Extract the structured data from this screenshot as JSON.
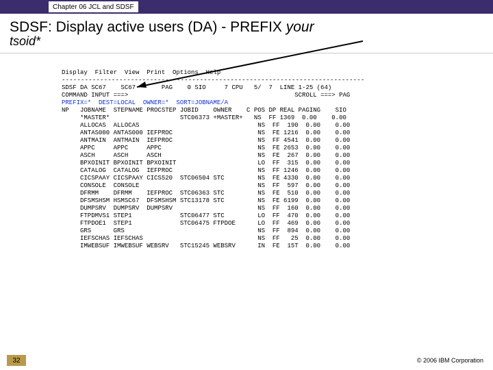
{
  "chapter_tab": "Chapter 06 JCL and SDSF",
  "title_line1_a": "SDSF: Display active users (DA)  -   PREFIX ",
  "title_line1_b": "your",
  "title_line2": "tsoid*",
  "menu_line": "Display  Filter  View  Print  Options  Help",
  "dashes": "-------------------------------------------------------------------------------",
  "status_line": "SDSF DA SC67    SC67       PAG    0 SIO     7 CPU   5/  7  LINE 1-25 (64)",
  "cmd_left": "COMMAND INPUT ===>",
  "cmd_right": "                                             SCROLL ===> PAG",
  "blue_line": "PREFIX=*  DEST=LOCAL  OWNER=*  SORT=JOBNAME/A",
  "header_cols": "NP   JOBNAME  STEPNAME PROCSTEP JOBID    OWNER    C POS DP REAL PAGING    SIO",
  "rows": [
    "     *MASTER*                   STC06373 +MASTER+   NS  FF 1369  0.00    0.00",
    "     ALLOCAS  ALLOCAS                                NS  FF  190  0.00    0.00",
    "     ANTAS000 ANTAS000 IEFPROC                       NS  FE 1216  0.00    0.00",
    "     ANTMAIN  ANTMAIN  IEFPROC                       NS  FF 4541  0.00    0.00",
    "     APPC     APPC     APPC                          NS  FE 2653  0.00    0.00",
    "     ASCH     ASCH     ASCH                          NS  FE  267  0.00    0.00",
    "     BPXOINIT BPXOINIT BPXOINIT                      LO  FF  315  0.00    0.00",
    "     CATALOG  CATALOG  IEFPROC                       NS  FF 1246  0.00    0.00",
    "     CICSPAAY CICSPAAY CICS520  STC06504 STC         NS  FE 4330  0.00    0.00",
    "     CONSOLE  CONSOLE                                NS  FF  597  0.00    0.00",
    "     DFRMM    DFRMM    IEFPROC  STC06363 STC         NS  FE  510  0.00    0.00",
    "     DFSMSHSM HSMSC67  DFSMSHSM STC13178 STC         NS  FE 6199  0.00    0.00",
    "     DUMPSRV  DUMPSRV  DUMPSRV                       NS  FF  160  0.00    0.00",
    "     FTPDMVS1 STEP1             STC06477 STC         LO  FF  470  0.00    0.00",
    "     FTPDOE1  STEP1             STC06475 FTPDOE      LO  FF  469  0.00    0.00",
    "     GRS      GRS                                    NS  FF  894  0.00    0.00",
    "     IEFSCHAS IEFSCHAS                               NS  FF   25  0.00    0.00",
    "     IMWEBSUF IMWEBSUF WEBSRV   STC15245 WEBSRV      IN  FE  15T  0.00    0.00"
  ],
  "page_num": "32",
  "copyright": "© 2006 IBM Corporation"
}
